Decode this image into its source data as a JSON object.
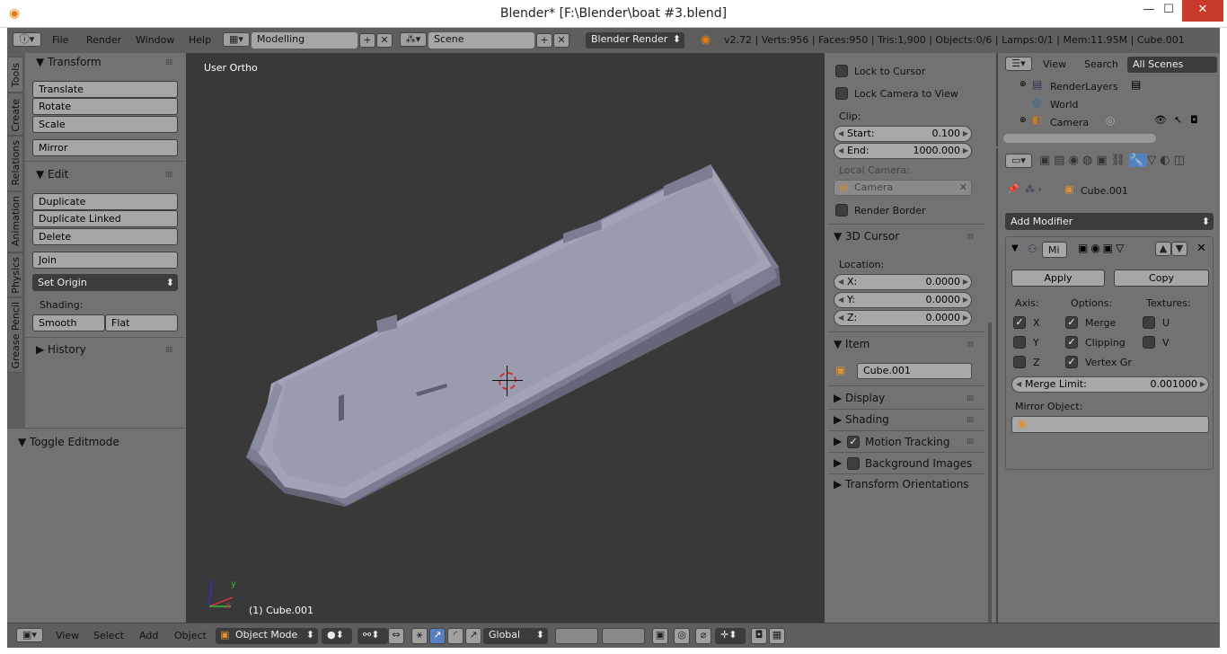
{
  "window": {
    "title": "Blender* [F:\\Blender\\boat #3.blend]",
    "min": "—",
    "max": "☐",
    "close": "✕"
  },
  "topbar": {
    "menus": [
      "File",
      "Render",
      "Window",
      "Help"
    ],
    "layout": "Modelling",
    "scene": "Scene",
    "engine": "Blender Render",
    "stats": "v2.72 | Verts:956 | Faces:950 | Tris:1,900 | Objects:0/6 | Lamps:0/1 | Mem:11.95M | Cube.001"
  },
  "tool_tabs": [
    "Tools",
    "Create",
    "Relations",
    "Animation",
    "Physics",
    "Grease Pencil"
  ],
  "tools": {
    "transform": "Transform",
    "translate": "Translate",
    "rotate": "Rotate",
    "scale": "Scale",
    "mirror": "Mirror",
    "edit": "Edit",
    "duplicate": "Duplicate",
    "duplicate_linked": "Duplicate Linked",
    "delete": "Delete",
    "join": "Join",
    "set_origin": "Set Origin",
    "shading": "Shading:",
    "smooth": "Smooth",
    "flat": "Flat",
    "history": "History",
    "toggle_editmode": "Toggle Editmode"
  },
  "viewport": {
    "view_name": "User Ortho",
    "object_label": "(1) Cube.001",
    "axis_x": "x",
    "axis_y": "y",
    "axis_z": "z"
  },
  "properties_panel": {
    "lock_cursor": "Lock to Cursor",
    "lock_camera": "Lock Camera to View",
    "clip": "Clip:",
    "start_label": "Start:",
    "start_value": "0.100",
    "end_label": "End:",
    "end_value": "1000.000",
    "local_camera": "Local Camera:",
    "camera": "Camera",
    "render_border": "Render Border",
    "cursor_3d": "3D Cursor",
    "location": "Location:",
    "x_label": "X:",
    "x_value": "0.0000",
    "y_label": "Y:",
    "y_value": "0.0000",
    "z_label": "Z:",
    "z_value": "0.0000",
    "item": "Item",
    "item_name": "Cube.001",
    "display": "Display",
    "shading": "Shading",
    "motion_tracking": "Motion Tracking",
    "background_images": "Background Images",
    "transform_orientations": "Transform Orientations"
  },
  "outliner": {
    "view": "View",
    "search": "Search",
    "filter": "All Scenes",
    "items": [
      "RenderLayers",
      "World",
      "Camera"
    ]
  },
  "modifiers": {
    "object": "Cube.001",
    "add_modifier": "Add Modifier",
    "mod_name": "Mi",
    "apply": "Apply",
    "copy": "Copy",
    "axis": "Axis:",
    "options": "Options:",
    "textures": "Textures:",
    "x": "X",
    "y": "Y",
    "z": "Z",
    "merge": "Merge",
    "clipping": "Clipping",
    "vertex_gr": "Vertex Gr",
    "u": "U",
    "v": "V",
    "merge_limit_label": "Merge Limit:",
    "merge_limit_value": "0.001000",
    "mirror_object": "Mirror Object:"
  },
  "bottombar": {
    "menus": [
      "View",
      "Select",
      "Add",
      "Object"
    ],
    "mode": "Object Mode",
    "orientation": "Global"
  }
}
